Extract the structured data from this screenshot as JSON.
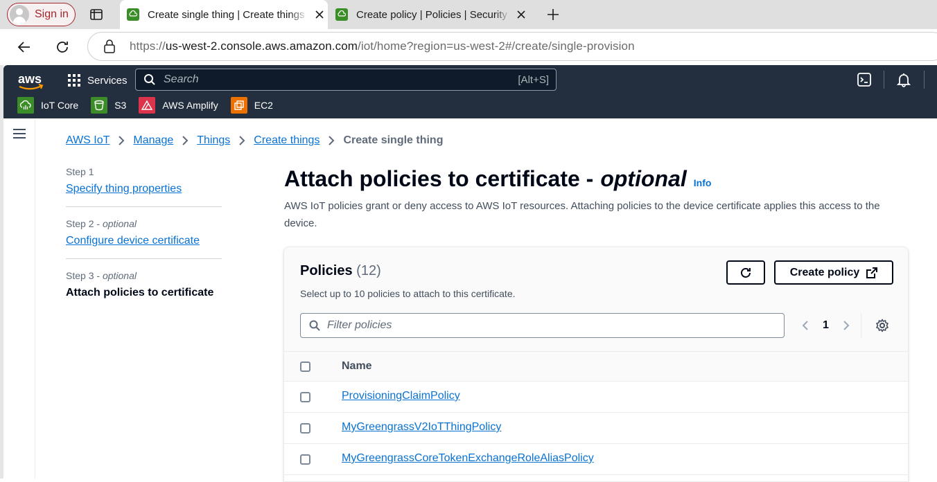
{
  "browser": {
    "signin_label": "Sign in",
    "tabs": [
      {
        "title": "Create single thing | Create things | Things | AWS IoT",
        "active": true
      },
      {
        "title": "Create policy | Policies | Security | AWS IoT",
        "active": false
      }
    ],
    "url_scheme": "https://",
    "url_host": "us-west-2.console.aws.amazon.com",
    "url_path": "/iot/home?region=us-west-2#/create/single-provision"
  },
  "aws_header": {
    "logo_text": "aws",
    "services_label": "Services",
    "search_placeholder": "Search",
    "search_shortcut": "[Alt+S]",
    "favorites": [
      {
        "label": "IoT Core",
        "color": "#3b8d28",
        "icon": "iot-core-icon"
      },
      {
        "label": "S3",
        "color": "#3b8d28",
        "icon": "s3-bucket-icon"
      },
      {
        "label": "AWS Amplify",
        "color": "#dd344c",
        "icon": "amplify-icon"
      },
      {
        "label": "EC2",
        "color": "#ed7100",
        "icon": "ec2-icon"
      }
    ]
  },
  "breadcrumb": {
    "items": [
      "AWS IoT",
      "Manage",
      "Things",
      "Create things"
    ],
    "current": "Create single thing"
  },
  "steps": [
    {
      "step": "Step 1",
      "optional": "",
      "label": "Specify thing properties",
      "link": true
    },
    {
      "step": "Step 2",
      "optional": "optional",
      "label": "Configure device certificate",
      "link": true
    },
    {
      "step": "Step 3",
      "optional": "optional",
      "label": "Attach policies to certificate",
      "link": false
    }
  ],
  "page": {
    "title": "Attach policies to certificate -",
    "title_optional": "optional",
    "info_link": "Info",
    "description": "AWS IoT policies grant or deny access to AWS IoT resources. Attaching policies to the device certificate applies this access to the device."
  },
  "policies": {
    "title": "Policies",
    "count": "(12)",
    "subtitle": "Select up to 10 policies to attach to this certificate.",
    "create_label": "Create policy",
    "filter_placeholder": "Filter policies",
    "page_number": "1",
    "column_name": "Name",
    "rows": [
      "ProvisioningClaimPolicy",
      "MyGreengrassV2IoTThingPolicy",
      "MyGreengrassCoreTokenExchangeRoleAliasPolicy"
    ]
  },
  "colors": {
    "aws_nav": "#232f3e",
    "link": "#0972d3",
    "text": "#000716"
  }
}
